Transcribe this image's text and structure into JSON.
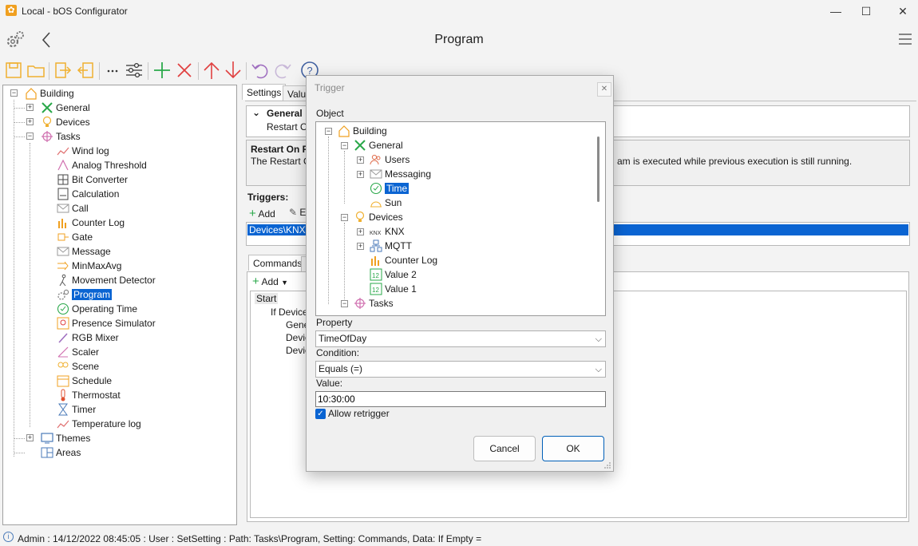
{
  "window": {
    "title": "Local - bOS Configurator",
    "minimize": "—",
    "maximize": "☐",
    "close": "✕"
  },
  "header": {
    "title": "Program"
  },
  "tree": {
    "root": "Building",
    "items": [
      "General",
      "Devices",
      "Tasks"
    ],
    "tasks": [
      "Wind log",
      "Analog Threshold",
      "Bit Converter",
      "Calculation",
      "Call",
      "Counter Log",
      "Gate",
      "Message",
      "MinMaxAvg",
      "Movement Detector",
      "Program",
      "Operating Time",
      "Presence Simulator",
      "RGB Mixer",
      "Scaler",
      "Scene",
      "Schedule",
      "Thermostat",
      "Timer",
      "Temperature log"
    ],
    "bottom": [
      "Themes",
      "Areas"
    ]
  },
  "right": {
    "tabs": [
      "Settings",
      "Value"
    ],
    "general_header": "General",
    "restart_short": "Restart O",
    "desc_title": "Restart On R",
    "desc_text_left": "The Restart O",
    "desc_text_right": "am is executed while previous execution is still running.",
    "triggers_label": "Triggers:",
    "add_label": "Add",
    "edit_short": "E",
    "trigger_row": "Devices\\KNX\\",
    "lower_tabs": [
      "Commands",
      "A"
    ],
    "commands_add": "Add",
    "commands": [
      "Start",
      "If Devices",
      "Gene",
      "Devic",
      "Devic"
    ]
  },
  "dialog": {
    "title": "Trigger",
    "close": "✕",
    "object_label": "Object",
    "tree": {
      "building": "Building",
      "general": "General",
      "users": "Users",
      "messaging": "Messaging",
      "time": "Time",
      "sun": "Sun",
      "devices": "Devices",
      "knx": "KNX",
      "mqtt": "MQTT",
      "counter_log": "Counter Log",
      "value2": "Value 2",
      "value1": "Value 1",
      "tasks": "Tasks"
    },
    "property_label": "Property",
    "property_value": "TimeOfDay",
    "condition_label": "Condition:",
    "condition_value": "Equals (=)",
    "value_label": "Value:",
    "value": "10:30:00",
    "allow_retrigger": "Allow retrigger",
    "cancel": "Cancel",
    "ok": "OK"
  },
  "status": {
    "text": "Admin : 14/12/2022 08:45:05 : User : SetSetting : Path: Tasks\\Program, Setting: Commands, Data: If Empty ="
  },
  "colors": {
    "selection": "#0a64d2",
    "accent_orange": "#f0a020",
    "accent_green": "#2aa84a",
    "accent_red": "#e04040",
    "accent_purple": "#a070c0"
  }
}
